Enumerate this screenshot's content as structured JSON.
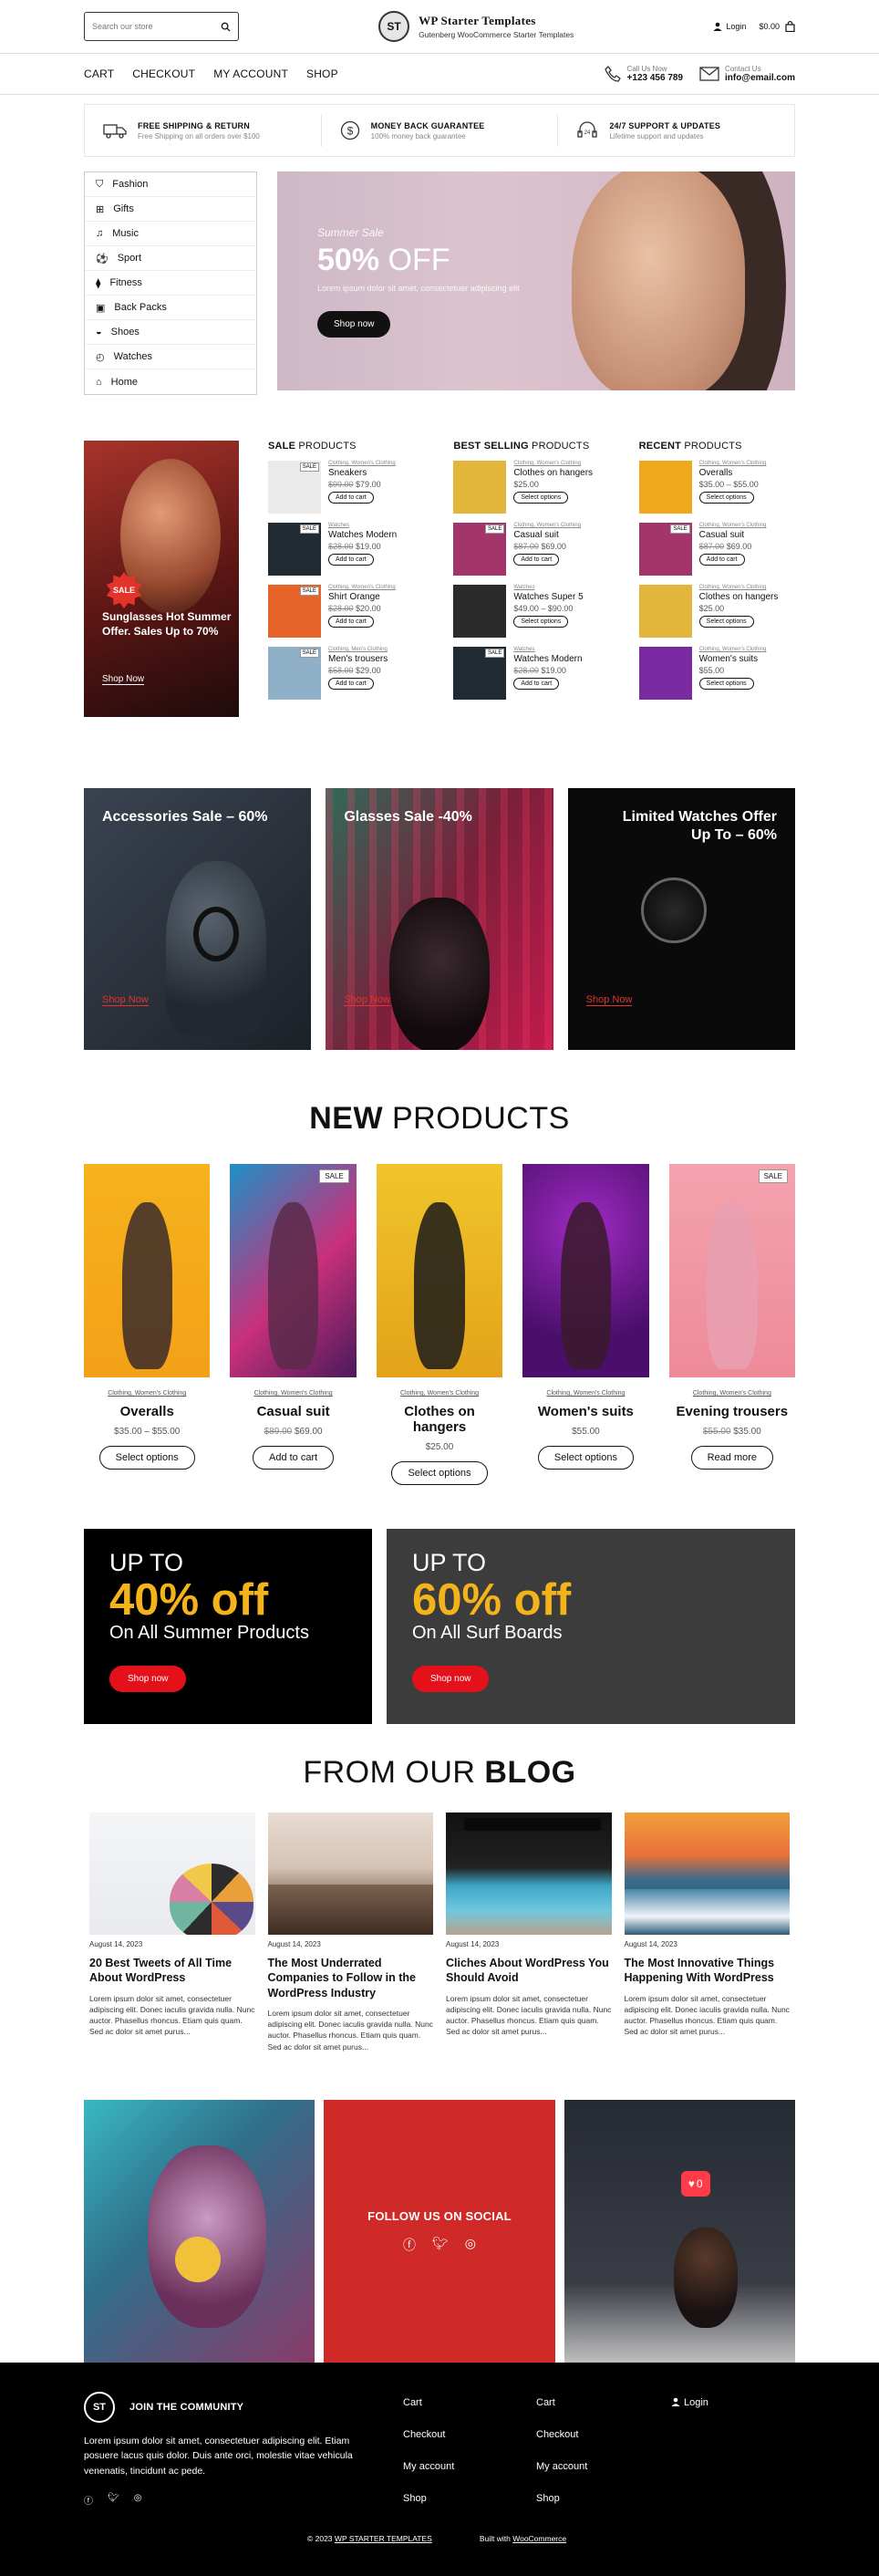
{
  "header": {
    "search_placeholder": "Search our store",
    "brand_title": "WP Starter Templates",
    "brand_subtitle": "Gutenberg WooCommerce Starter Templates",
    "login": "Login",
    "cart_total": "$0.00",
    "logo_text": "ST"
  },
  "nav": {
    "items": [
      "CART",
      "CHECKOUT",
      "MY ACCOUNT",
      "SHOP"
    ],
    "phone_label": "Call Us Now",
    "phone": "+123 456 789",
    "email_label": "Contact Us",
    "email": "info@email.com"
  },
  "features": [
    {
      "icon": "truck-icon",
      "title": "FREE SHIPPING & RETURN",
      "sub": "Free Shipping on all orders over $100"
    },
    {
      "icon": "dollar-icon",
      "title": "MONEY BACK GUARANTEE",
      "sub": "100% money back guarantee"
    },
    {
      "icon": "support-icon",
      "title": "24/7 SUPPORT & UPDATES",
      "sub": "Lifetime support and updates"
    }
  ],
  "categories": [
    "Fashion",
    "Gifts",
    "Music",
    "Sport",
    "Fitness",
    "Back Packs",
    "Shoes",
    "Watches",
    "Home"
  ],
  "hero": {
    "sub": "Summer Sale",
    "pct": "50%",
    "off": "OFF",
    "text": "Lorem ipsum dolor sit amet, consectetuer adipiscing elit",
    "button": "Shop now"
  },
  "promo": {
    "badge": "SALE",
    "title": "Sunglasses Hot Summer Offer. Sales Up to 70%",
    "link": "Shop Now"
  },
  "product_lists": [
    {
      "title_bold": "SALE",
      "title_rest": " PRODUCTS",
      "items": [
        {
          "cat": "Clothing, Women's Clothing",
          "name": "Sneakers",
          "old": "$99.00",
          "price": "$79.00",
          "btn": "Add to cart",
          "sale": "SALE",
          "color": "#eaeaea"
        },
        {
          "cat": "Watches",
          "name": "Watches Modern",
          "old": "$28.00",
          "price": "$19.00",
          "btn": "Add to cart",
          "sale": "SALE",
          "color": "#1f2a33"
        },
        {
          "cat": "Clothing, Women's Clothing",
          "name": "Shirt Orange",
          "old": "$28.00",
          "price": "$20.00",
          "btn": "Add to cart",
          "sale": "SALE",
          "color": "#e6632a"
        },
        {
          "cat": "Clothing, Men's Clothing",
          "name": "Men's trousers",
          "old": "$58.00",
          "price": "$29.00",
          "btn": "Add to cart",
          "sale": "SALE",
          "color": "#8fb0c6"
        }
      ]
    },
    {
      "title_bold": "BEST SELLING",
      "title_rest": " PRODUCTS",
      "items": [
        {
          "cat": "Clothing, Women's Clothing",
          "name": "Clothes on hangers",
          "old": "",
          "price": "$25.00",
          "btn": "Select options",
          "sale": "",
          "color": "#e2b63a"
        },
        {
          "cat": "Clothing, Women's Clothing",
          "name": "Casual suit",
          "old": "$87.00",
          "price": "$69.00",
          "btn": "Add to cart",
          "sale": "SALE",
          "color": "#a3356b"
        },
        {
          "cat": "Watches",
          "name": "Watches Super 5",
          "old": "",
          "price": "$49.00 – $90.00",
          "btn": "Select options",
          "sale": "",
          "color": "#2b2b2b"
        },
        {
          "cat": "Watches",
          "name": "Watches Modern",
          "old": "$28.00",
          "price": "$19.00",
          "btn": "Add to cart",
          "sale": "SALE",
          "color": "#1f2a33"
        }
      ]
    },
    {
      "title_bold": "RECENT",
      "title_rest": " PRODUCTS",
      "items": [
        {
          "cat": "Clothing, Women's Clothing",
          "name": "Overalls",
          "old": "",
          "price": "$35.00 – $55.00",
          "btn": "Select options",
          "sale": "",
          "color": "#f0a81c"
        },
        {
          "cat": "Clothing, Women's Clothing",
          "name": "Casual suit",
          "old": "$87.00",
          "price": "$69.00",
          "btn": "Add to cart",
          "sale": "SALE",
          "color": "#a3356b"
        },
        {
          "cat": "Clothing, Women's Clothing",
          "name": "Clothes on hangers",
          "old": "",
          "price": "$25.00",
          "btn": "Select options",
          "sale": "",
          "color": "#e2b63a"
        },
        {
          "cat": "Clothing, Women's Clothing",
          "name": "Women's suits",
          "old": "",
          "price": "$55.00",
          "btn": "Select options",
          "sale": "",
          "color": "#7a2aa0"
        }
      ]
    }
  ],
  "offers": [
    {
      "title": "Accessories Sale – 60%",
      "link": "Shop Now",
      "align": "left"
    },
    {
      "title": "Glasses Sale -40%",
      "link": "Shop Now",
      "align": "left"
    },
    {
      "title": "Limited Watches Offer\nUp To – 60%",
      "link": "Shop Now",
      "align": "right"
    }
  ],
  "new_products": {
    "title_bold": "NEW",
    "title_rest": " PRODUCTS",
    "items": [
      {
        "cat": "Clothing, Women's Clothing",
        "name": "Overalls",
        "old": "",
        "price": "$35.00 – $55.00",
        "btn": "Select options",
        "sale": ""
      },
      {
        "cat": "Clothing, Women's Clothing",
        "name": "Casual suit",
        "old": "$89.00",
        "price": "$69.00",
        "btn": "Add to cart",
        "sale": "SALE"
      },
      {
        "cat": "Clothing, Women's Clothing",
        "name": "Clothes on hangers",
        "old": "",
        "price": "$25.00",
        "btn": "Select options",
        "sale": ""
      },
      {
        "cat": "Clothing, Women's Clothing",
        "name": "Women's suits",
        "old": "",
        "price": "$55.00",
        "btn": "Select options",
        "sale": ""
      },
      {
        "cat": "Clothing, Women's Clothing",
        "name": "Evening trousers",
        "old": "$55.00",
        "price": "$35.00",
        "btn": "Read more",
        "sale": "SALE"
      }
    ]
  },
  "banners": [
    {
      "up": "UP TO",
      "pct": "40% off",
      "desc": "On All Summer Products",
      "btn": "Shop now"
    },
    {
      "up": "UP TO",
      "pct": "60% off",
      "desc": "On All Surf Boards",
      "btn": "Shop now"
    }
  ],
  "blog": {
    "title_rest": "FROM OUR ",
    "title_bold": "BLOG",
    "posts": [
      {
        "date": "August 14, 2023",
        "title": "20 Best Tweets of All Time About WordPress",
        "excerpt": "Lorem ipsum dolor sit amet, consectetuer adipiscing elit. Donec iaculis gravida nulla. Nunc auctor. Phasellus rhoncus. Etiam quis quam. Sed ac dolor sit amet purus..."
      },
      {
        "date": "August 14, 2023",
        "title": "The Most Underrated Companies to Follow in the WordPress Industry",
        "excerpt": "Lorem ipsum dolor sit amet, consectetuer adipiscing elit. Donec iaculis gravida nulla. Nunc auctor. Phasellus rhoncus. Etiam quis quam. Sed ac dolor sit amet purus..."
      },
      {
        "date": "August 14, 2023",
        "title": "Cliches About WordPress You Should Avoid",
        "excerpt": "Lorem ipsum dolor sit amet, consectetuer adipiscing elit. Donec iaculis gravida nulla. Nunc auctor. Phasellus rhoncus. Etiam quis quam. Sed ac dolor sit amet purus..."
      },
      {
        "date": "August 14, 2023",
        "title": "The Most Innovative Things Happening With WordPress",
        "excerpt": "Lorem ipsum dolor sit amet, consectetuer adipiscing elit. Donec iaculis gravida nulla. Nunc auctor. Phasellus rhoncus. Etiam quis quam. Sed ac dolor sit amet purus..."
      }
    ]
  },
  "social": {
    "title": "FOLLOW US ON SOCIAL",
    "notif": "0"
  },
  "footer": {
    "logo_text": "ST",
    "join": "JOIN THE COMMUNITY",
    "text": "Lorem ipsum dolor sit amet, consectetuer adipiscing elit. Etiam posuere lacus quis dolor. Duis ante orci, molestie vitae vehicula venenatis, tincidunt ac pede.",
    "col1": [
      "Cart",
      "Checkout",
      "My account",
      "Shop"
    ],
    "col2": [
      "Cart",
      "Checkout",
      "My account",
      "Shop"
    ],
    "login": "Login",
    "copyright": "© 2023",
    "copyright_link": "WP STARTER TEMPLATES",
    "built": "Built with",
    "built_link": "WooCommerce"
  },
  "colors": {
    "accent_red": "#e4101a",
    "accent_yellow": "#f5b31b",
    "social_red": "#cf2a27"
  }
}
